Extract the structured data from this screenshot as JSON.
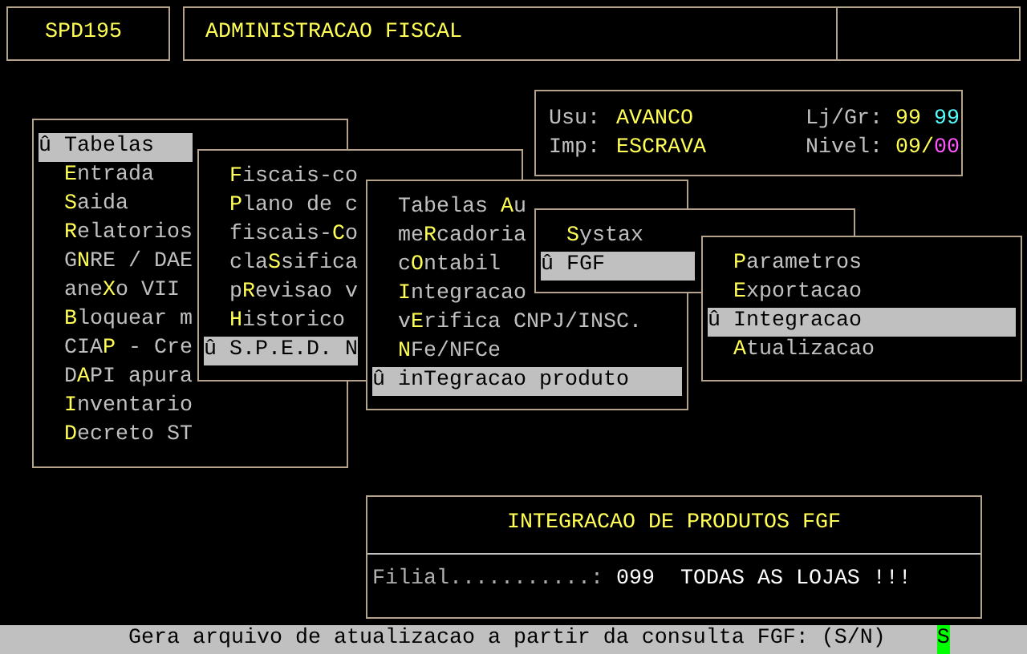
{
  "header": {
    "program": "SPD195",
    "title": "ADMINISTRACAO FISCAL"
  },
  "session": {
    "user_label": "Usu:",
    "user": "AVANCO",
    "printer_label": "Imp:",
    "printer": "ESCRAVA",
    "store_label": "Lj/Gr:",
    "store": "99",
    "group": "99",
    "access_label": "Nivel:",
    "access": "09/",
    "access_group": "00"
  },
  "menus": [
    {
      "items": [
        {
          "text": "û Tabelas",
          "selected": true
        },
        {
          "key": "E",
          "after": "ntrada",
          "selected": false
        },
        {
          "key": "S",
          "after": "aida",
          "selected": false
        },
        {
          "key": "R",
          "after": "elatorios",
          "selected": false
        },
        {
          "before": "G",
          "key": "N",
          "after": "RE / DAE",
          "selected": false
        },
        {
          "before": "ane",
          "key": "X",
          "after": "o VII",
          "selected": false
        },
        {
          "key": "B",
          "after": "loquear m",
          "selected": false
        },
        {
          "before": "CIA",
          "key": "P",
          "after": " - Cre",
          "selected": false
        },
        {
          "before": "D",
          "key": "A",
          "after": "PI apura",
          "selected": false
        },
        {
          "key": "I",
          "after": "nventario",
          "selected": false
        },
        {
          "key": "D",
          "after": "ecreto ST",
          "selected": false
        }
      ]
    },
    {
      "items": [
        {
          "key": "F",
          "after": "iscais-co",
          "selected": false
        },
        {
          "key": "P",
          "after": "lano de c",
          "selected": false
        },
        {
          "before": "fiscais-",
          "key": "C",
          "after": "o",
          "selected": false
        },
        {
          "before": "cla",
          "key": "S",
          "after": "sifica",
          "selected": false
        },
        {
          "before": "p",
          "key": "R",
          "after": "evisao v",
          "selected": false
        },
        {
          "key": "H",
          "after": "istorico",
          "selected": false
        },
        {
          "text": "û S.P.E.D. N",
          "selected": true
        }
      ]
    },
    {
      "items": [
        {
          "before": "Tabelas ",
          "key": "A",
          "after": "u",
          "selected": false
        },
        {
          "before": "me",
          "key": "R",
          "after": "cadoria",
          "selected": false
        },
        {
          "before": "c",
          "key": "O",
          "after": "ntabil",
          "selected": false
        },
        {
          "key": "I",
          "after": "ntegracao",
          "selected": false
        },
        {
          "before": "v",
          "key": "E",
          "after": "rifica CNPJ/INSC.",
          "selected": false
        },
        {
          "key": "N",
          "after": "Fe/NFCe",
          "selected": false
        },
        {
          "text": "û inTegracao produto",
          "selected": true
        }
      ]
    },
    {
      "items": [
        {
          "key": "S",
          "after": "ystax",
          "selected": false
        },
        {
          "text": "û FGF",
          "selected": true
        }
      ]
    },
    {
      "items": [
        {
          "key": "P",
          "after": "arametros",
          "selected": false
        },
        {
          "key": "E",
          "after": "xportacao",
          "selected": false
        },
        {
          "text": "û Integracao",
          "selected": true
        },
        {
          "key": "A",
          "after": "tualizacao",
          "selected": false
        }
      ]
    }
  ],
  "dialog": {
    "title": "INTEGRACAO DE PRODUTOS FGF",
    "field_label": "Filial...........:",
    "field_value": "099  TODAS AS LOJAS !!!"
  },
  "status_bar": {
    "prompt": "Gera arquivo de atualizacao a partir da consulta FGF: (S/N)",
    "answer": "S"
  }
}
